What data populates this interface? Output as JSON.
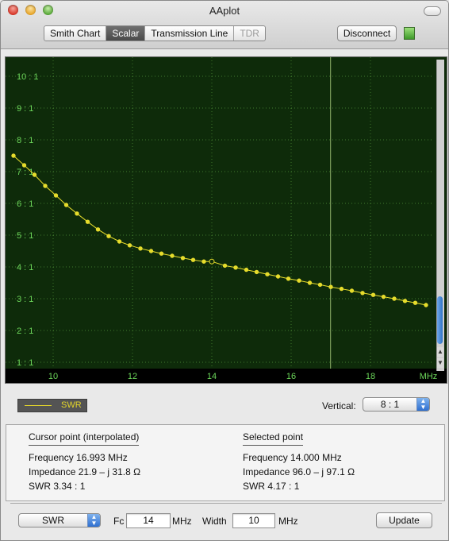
{
  "window": {
    "title": "AAplot"
  },
  "toolbar": {
    "tabs": [
      {
        "label": "Smith Chart",
        "state": "normal"
      },
      {
        "label": "Scalar",
        "state": "active"
      },
      {
        "label": "Transmission Line",
        "state": "normal"
      },
      {
        "label": "TDR",
        "state": "disabled"
      }
    ],
    "disconnect_label": "Disconnect",
    "status_color": "#5cbf3f"
  },
  "chart_data": {
    "type": "line",
    "series": [
      {
        "name": "SWR",
        "color": "#e6dc2c",
        "x": [
          9.0,
          9.27,
          9.53,
          9.8,
          10.07,
          10.33,
          10.6,
          10.87,
          11.13,
          11.4,
          11.67,
          11.93,
          12.2,
          12.47,
          12.73,
          13.0,
          13.27,
          13.53,
          13.8,
          14.0,
          14.33,
          14.6,
          14.87,
          15.13,
          15.4,
          15.67,
          15.93,
          16.2,
          16.47,
          16.73,
          17.0,
          17.27,
          17.53,
          17.8,
          18.07,
          18.33,
          18.6,
          18.87,
          19.13,
          19.4
        ],
        "y": [
          7.5,
          7.2,
          6.9,
          6.55,
          6.25,
          5.95,
          5.68,
          5.42,
          5.18,
          4.97,
          4.8,
          4.68,
          4.58,
          4.5,
          4.42,
          4.35,
          4.28,
          4.22,
          4.17,
          4.17,
          4.04,
          3.98,
          3.91,
          3.84,
          3.77,
          3.7,
          3.63,
          3.57,
          3.5,
          3.44,
          3.37,
          3.31,
          3.25,
          3.18,
          3.12,
          3.06,
          3.0,
          2.93,
          2.87,
          2.8
        ]
      }
    ],
    "x_ticks": [
      "10",
      "12",
      "14",
      "16",
      "18"
    ],
    "x_unit": "MHz",
    "y_ticks": [
      "1 : 1",
      "2 : 1",
      "3 : 1",
      "4 : 1",
      "5 : 1",
      "6 : 1",
      "7 : 1",
      "8 : 1",
      "9 : 1",
      "10 : 1"
    ],
    "xlim": [
      8.8,
      19.6
    ],
    "ylim": [
      0.8,
      10.6
    ],
    "cursor_x": 16.993,
    "selected_point": {
      "x": 14.0,
      "y": 4.17
    },
    "grid": true,
    "background": "#0e2b0a",
    "grid_color": "#6fbf4f",
    "tick_color": "#6cd65a"
  },
  "legend": {
    "label": "SWR"
  },
  "vertical": {
    "label": "Vertical:",
    "value": "8 : 1"
  },
  "cursor_point": {
    "title": "Cursor point (interpolated)",
    "frequency": "Frequency  16.993 MHz",
    "impedance": "Impedance  21.9 – j 31.8 Ω",
    "swr": "SWR   3.34 : 1"
  },
  "selected_point": {
    "title": "Selected point",
    "frequency": "Frequency  14.000 MHz",
    "impedance": "Impedance  96.0 – j 97.1 Ω",
    "swr": "SWR   4.17 : 1"
  },
  "controls": {
    "measure_select": "SWR",
    "fc_label": "Fc",
    "fc_value": "14",
    "fc_unit": "MHz",
    "width_label": "Width",
    "width_value": "10",
    "width_unit": "MHz",
    "update_label": "Update"
  }
}
